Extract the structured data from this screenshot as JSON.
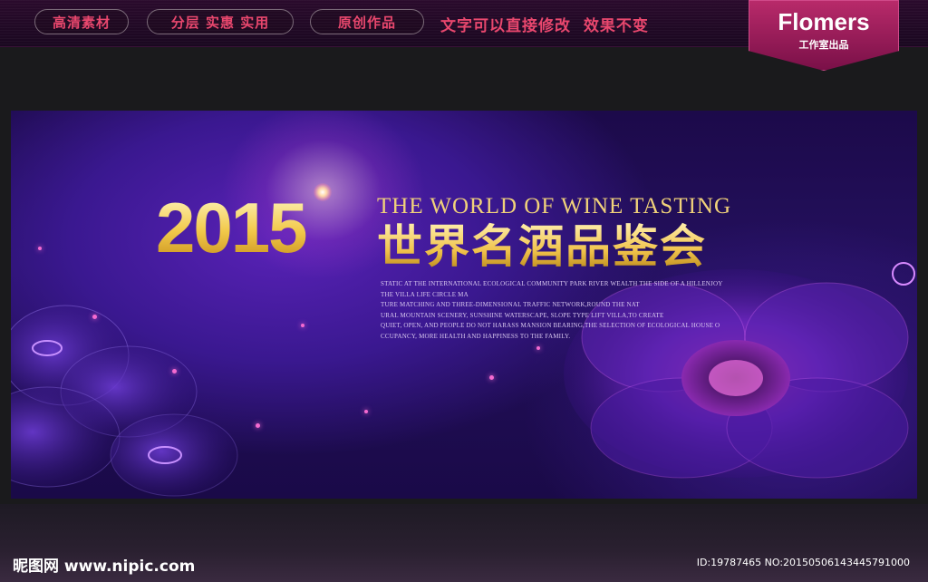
{
  "topbar": {
    "pills": [
      "高清素材",
      "分层 实惠 实用",
      "原创作品"
    ],
    "slogan": "文字可以直接修改  效果不变"
  },
  "brand": {
    "name": "Flomers",
    "subtitle": "工作室出品"
  },
  "banner": {
    "year": "2015",
    "en_title": "THE WORLD OF WINE TASTING",
    "cn_title": "世界名酒品鉴会",
    "paragraph": [
      "STATIC AT THE INTERNATIONAL ECOLOGICAL COMMUNITY PARK RIVER WEALTH THE SIDE OF A HILLENJOY",
      "THE VILLA LIFE CIRCLE MA",
      "TURE MATCHING AND THREE-DIMENSIONAL TRAFFIC NETWORK,ROUND THE NAT",
      "URAL MOUNTAIN SCENERY, SUNSHINE WATERSCAPE, SLOPE TYPE LIFT VILLA,TO CREATE",
      "QUIET, OPEN, AND PEOPLE DO NOT HARASS MANSION BEARING,THE SELECTION OF ECOLOGICAL HOUSE O",
      "CCUPANCY, MORE HEALTH AND HAPPINESS TO THE FAMILY."
    ]
  },
  "footer": {
    "watermark": "昵图网 www.nipic.com",
    "id_text": "ID:19787465 NO:20150506143445791000"
  },
  "colors": {
    "accent_red": "#e8456c",
    "brand_magenta": "#b82a6a",
    "gold": "#f2c94a",
    "banner_purple": "#3a1890"
  }
}
